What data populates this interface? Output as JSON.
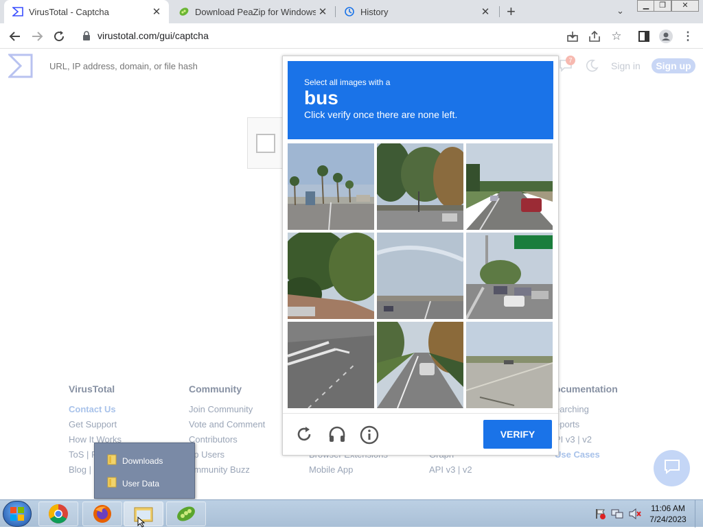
{
  "browser": {
    "tabs": [
      {
        "title": "VirusTotal - Captcha",
        "icon": "virustotal-icon"
      },
      {
        "title": "Download PeaZip for Windows 6",
        "icon": "peazip-icon"
      },
      {
        "title": "History",
        "icon": "history-icon"
      }
    ],
    "new_tab": "+",
    "url": "virustotal.com/gui/captcha"
  },
  "vt": {
    "search_placeholder": "URL, IP address, domain, or file hash",
    "notification_count": "7",
    "sign_in": "Sign in",
    "sign_up": "Sign up"
  },
  "footer": {
    "col1": {
      "heading": "VirusTotal",
      "links": [
        "Contact Us",
        "Get Support",
        "How It Works",
        "ToS | P",
        "Blog | "
      ]
    },
    "col2": {
      "heading": "Community",
      "links": [
        "Join Community",
        "Vote and Comment",
        "Contributors",
        "op Users",
        "ommunity Buzz"
      ]
    },
    "col3": {
      "links": [
        "Browser Extensions",
        "Mobile App"
      ]
    },
    "col4": {
      "links": [
        "Graph",
        "API v3 | v2"
      ]
    },
    "col5": {
      "heading": "ocumentation",
      "links": [
        "earching",
        "eports",
        "PI v3 | v2",
        "Use Cases"
      ]
    }
  },
  "captcha": {
    "instruction": "Select all images with a",
    "target": "bus",
    "subtext": "Click verify once there are none left.",
    "verify_label": "VERIFY",
    "tiles": [
      "street-palm-trees-bus",
      "trees-intersection",
      "road-red-car",
      "trees-canopy",
      "overpass-sky",
      "highway-traffic-sign",
      "crosswalk-road",
      "tree-lined-road-car",
      "open-road-field"
    ]
  },
  "taskbar": {
    "jumplist": [
      "Downloads",
      "User Data"
    ],
    "time": "11:06 AM",
    "date": "7/24/2023"
  },
  "colors": {
    "accent": "#1a73e8",
    "tabstrip": "#dee1e6",
    "footer_text": "#9aa5b7"
  }
}
